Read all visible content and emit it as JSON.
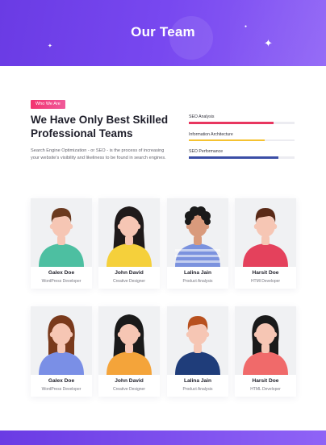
{
  "hero": {
    "title": "Our Team"
  },
  "intro": {
    "tag": "Who We Are",
    "heading": "We Have Only Best Skilled Professional Teams",
    "description": "Search Engine Optimization - or SEO - is the process of increasing your website's visibility and likeliness to be found in search engines."
  },
  "skills": [
    {
      "label": "SEO Analysis",
      "percent": 80,
      "color": "#e8365f"
    },
    {
      "label": "Information Architecture",
      "percent": 72,
      "color": "#f5c231"
    },
    {
      "label": "SEO Performance",
      "percent": 85,
      "color": "#3b4ea6"
    }
  ],
  "team_row1": [
    {
      "name": "Galex Doe",
      "role": "WordPress Developer",
      "shirt": "#4dbfa1",
      "hair": "#6b3a1f",
      "skin": "#f6c6b4",
      "style": "short"
    },
    {
      "name": "John David",
      "role": "Creative Designer",
      "shirt": "#f5d03b",
      "hair": "#1f1a1a",
      "skin": "#f6c6b4",
      "style": "long"
    },
    {
      "name": "Lalina Jain",
      "role": "Product Analysis",
      "shirt": "#7b92de",
      "hair": "#1a1a1a",
      "skin": "#d99a7c",
      "style": "curly"
    },
    {
      "name": "Harsit Doe",
      "role": "HTMl Developer",
      "shirt": "#e4415c",
      "hair": "#5a2a17",
      "skin": "#f6c6b4",
      "style": "short"
    }
  ],
  "team_row2": [
    {
      "name": "Galex Doe",
      "role": "WordPress Developer",
      "shirt": "#7a8fe6",
      "hair": "#7a3a1c",
      "skin": "#f6c6b4",
      "style": "bob"
    },
    {
      "name": "John David",
      "role": "Creative Designer",
      "shirt": "#f4a43a",
      "hair": "#1a1a1a",
      "skin": "#f6c6b4",
      "style": "long"
    },
    {
      "name": "Lalina Jain",
      "role": "Product Analysis",
      "shirt": "#1f3d7a",
      "hair": "#b8501e",
      "skin": "#f6c6b4",
      "style": "short"
    },
    {
      "name": "Harsit Doe",
      "role": "HTML Developer",
      "shirt": "#f06a6a",
      "hair": "#1a1a1a",
      "skin": "#f6c6b4",
      "style": "bob"
    }
  ]
}
